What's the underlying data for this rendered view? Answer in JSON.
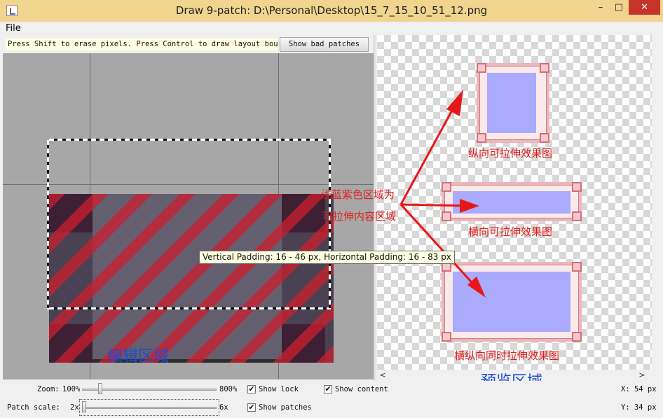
{
  "window": {
    "title": "Draw 9-patch: D:\\Personal\\Desktop\\15_7_15_10_51_12.png",
    "minimize_glyph": "–",
    "maximize_glyph": "□",
    "close_glyph": "✕"
  },
  "menu": {
    "file": "File"
  },
  "toolbar": {
    "hint": "Press Shift to erase pixels. Press Control to draw layout bounds",
    "bad_patches_label": "Show bad patches"
  },
  "editor": {
    "tooltip": "Vertical Padding: 16 - 46 px, Horizontal Padding: 16 - 83 px",
    "region_label": "编辑区域"
  },
  "preview": {
    "vertical_label": "纵向可拉伸效果图",
    "horizontal_label": "横向可拉伸效果图",
    "both_label": "横纵向同时拉伸效果图",
    "region_label": "预览区域"
  },
  "annotation": {
    "line1": "浅蓝紫色区域为",
    "line2": "可拉伸内容区域"
  },
  "scroll": {
    "right_arrow": ">",
    "left_arrow": "<"
  },
  "controls": {
    "zoom_label": "Zoom:",
    "zoom_min": "100%",
    "zoom_max": "800%",
    "zoom_value": 0.12,
    "patch_scale_label": "Patch scale:",
    "patch_min": "2x",
    "patch_max": "6x",
    "patch_value": 0.0,
    "show_lock": {
      "label": "Show lock",
      "checked": true
    },
    "show_content": {
      "label": "Show content",
      "checked": true
    },
    "show_patches": {
      "label": "Show patches",
      "checked": true
    },
    "x_readout": "X: 54 px",
    "y_readout": "Y: 34 px"
  },
  "colors": {
    "title_bar": "#f1d58f",
    "close_button": "#c7342a",
    "stretch_area": "#aaaafe",
    "annotation": "#e11c1c",
    "region_label": "#1f4cd4"
  }
}
